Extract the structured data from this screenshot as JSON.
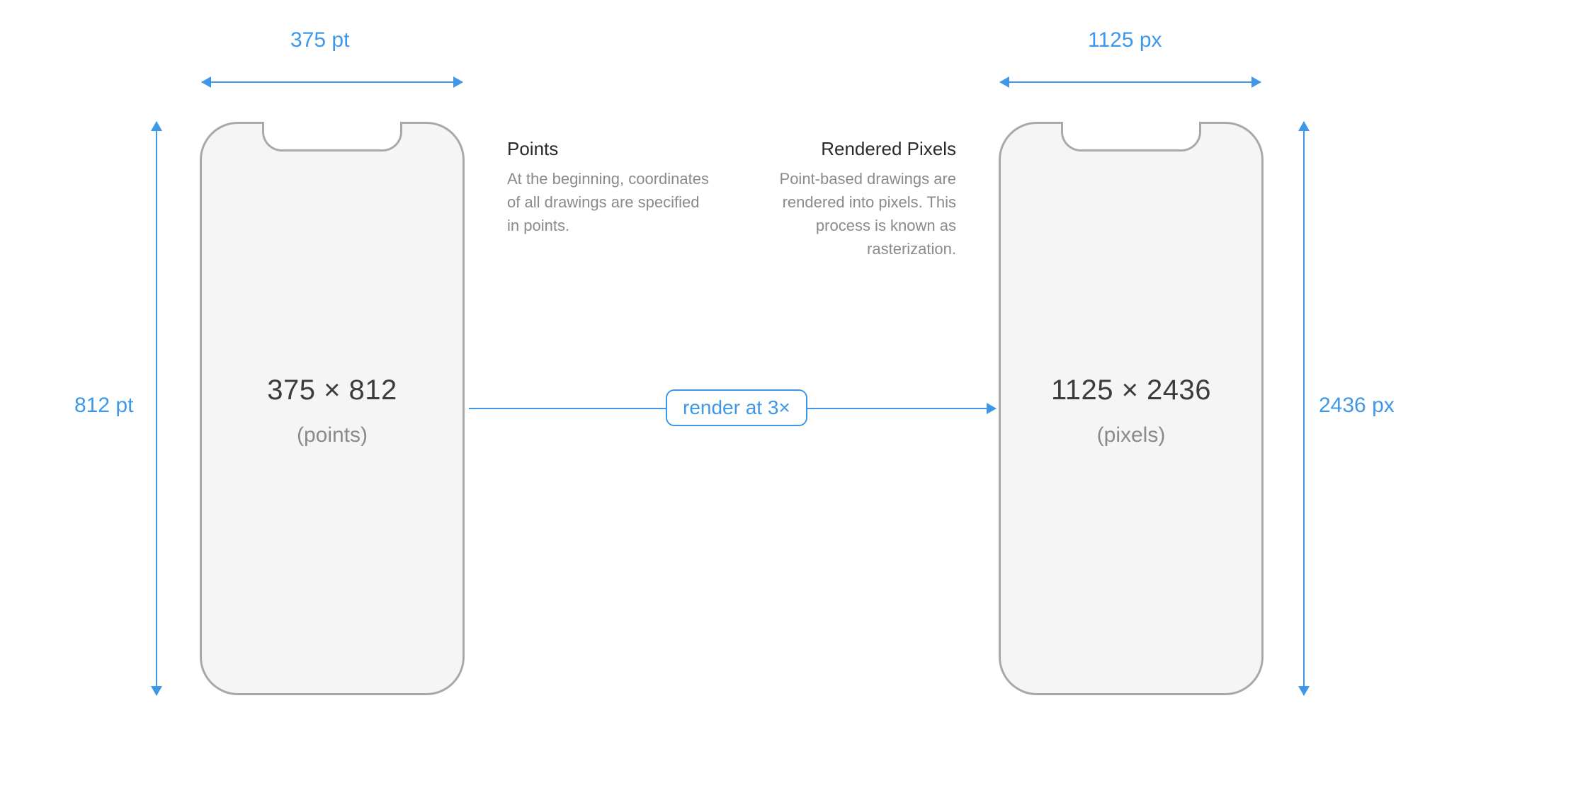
{
  "left_phone": {
    "width_label": "375 pt",
    "height_label": "812 pt",
    "resolution": "375 × 812",
    "unit": "(points)"
  },
  "right_phone": {
    "width_label": "1125 px",
    "height_label": "2436 px",
    "resolution": "1125 × 2436",
    "unit": "(pixels)"
  },
  "textblocks": {
    "points": {
      "title": "Points",
      "body": "At the beginning, coordinates of all drawings are specified in points."
    },
    "rendered": {
      "title": "Rendered Pixels",
      "body": "Point-based drawings are rendered into pixels. This process is known as rasterization."
    }
  },
  "flow": {
    "render_label": "render at 3×"
  },
  "colors": {
    "accent": "#3E98E7",
    "phone_border": "#A8A9AA",
    "phone_fill": "#F5F5F5",
    "text_muted": "#8a8a8a",
    "text_primary": "#3c3c3c"
  }
}
